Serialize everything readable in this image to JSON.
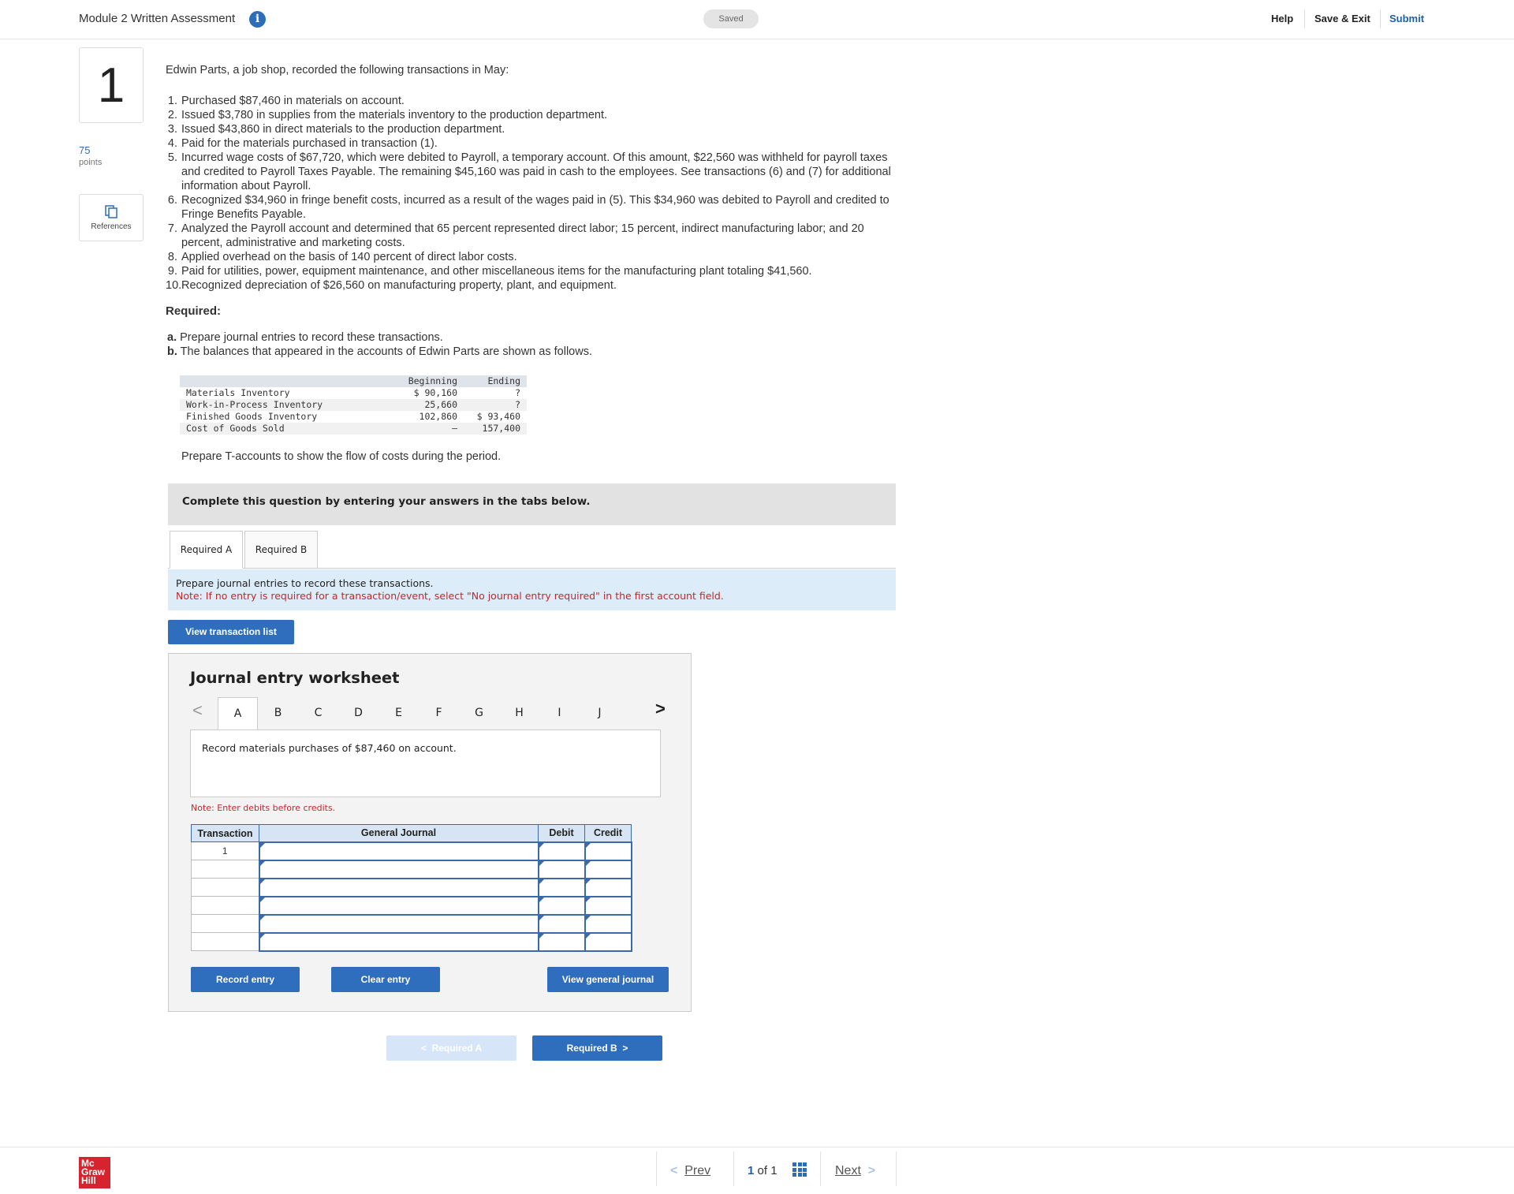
{
  "header": {
    "title": "Module 2 Written Assessment",
    "info_icon": "i",
    "saved": "Saved",
    "help": "Help",
    "save_exit": "Save & Exit",
    "submit": "Submit"
  },
  "question": {
    "number": "1",
    "points": "75",
    "points_label": "points",
    "references": "References"
  },
  "problem": {
    "intro": "Edwin Parts, a job shop, recorded the following transactions in May:",
    "transactions": [
      {
        "n": "1.",
        "text": "Purchased $87,460 in materials on account."
      },
      {
        "n": "2.",
        "text": "Issued $3,780 in supplies from the materials inventory to the production department."
      },
      {
        "n": "3.",
        "text": "Issued $43,860 in direct materials to the production department."
      },
      {
        "n": "4.",
        "text": "Paid for the materials purchased in transaction (1)."
      },
      {
        "n": "5.",
        "text": "Incurred wage costs of $67,720, which were debited to Payroll, a temporary account. Of this amount, $22,560 was withheld for payroll taxes and credited to Payroll Taxes Payable. The remaining $45,160 was paid in cash to the employees. See transactions (6) and (7) for additional information about Payroll."
      },
      {
        "n": "6.",
        "text": "Recognized $34,960 in fringe benefit costs, incurred as a result of the wages paid in (5). This $34,960 was debited to Payroll and credited to Fringe Benefits Payable."
      },
      {
        "n": "7.",
        "text": "Analyzed the Payroll account and determined that 65 percent represented direct labor; 15 percent, indirect manufacturing labor; and 20 percent, administrative and marketing costs."
      },
      {
        "n": "8.",
        "text": "Applied overhead on the basis of 140 percent of direct labor costs."
      },
      {
        "n": "9.",
        "text": "Paid for utilities, power, equipment maintenance, and other miscellaneous items for the manufacturing plant totaling $41,560."
      },
      {
        "n": "10.",
        "text": "Recognized depreciation of $26,560 on manufacturing property, plant, and equipment."
      }
    ],
    "required_heading": "Required:",
    "req_a_letter": "a.",
    "req_a": "Prepare journal entries to record these transactions.",
    "req_b_letter": "b.",
    "req_b": "The balances that appeared in the accounts of Edwin Parts are shown as follows.",
    "balances": {
      "headers": [
        "",
        "Beginning",
        "Ending"
      ],
      "rows": [
        [
          "Materials Inventory",
          "$ 90,160",
          "?"
        ],
        [
          "Work-in-Process Inventory",
          "25,660",
          "?"
        ],
        [
          "Finished Goods Inventory",
          "102,860",
          "$ 93,460"
        ],
        [
          "Cost of Goods Sold",
          "–",
          "157,400"
        ]
      ]
    },
    "t_accounts": "Prepare T-accounts to show the flow of costs during the period."
  },
  "complete_box": "Complete this question by entering your answers in the tabs below.",
  "tabs": [
    "Required A",
    "Required B"
  ],
  "instructions": {
    "line1": "Prepare journal entries to record these transactions.",
    "line2": "Note: If no entry is required for a transaction/event, select \"No journal entry required\" in the first account field."
  },
  "view_transaction_list": "View transaction list",
  "worksheet": {
    "title": "Journal entry worksheet",
    "prev": "<",
    "next": ">",
    "tabs": [
      "A",
      "B",
      "C",
      "D",
      "E",
      "F",
      "G",
      "H",
      "I",
      "J"
    ],
    "active_tab": "A",
    "description": "Record materials purchases of $87,460 on account.",
    "note": "Note: Enter debits before credits.",
    "columns": [
      "Transaction",
      "General Journal",
      "Debit",
      "Credit"
    ],
    "rows": [
      {
        "transaction": "1",
        "account": "",
        "debit": "",
        "credit": ""
      },
      {
        "transaction": "",
        "account": "",
        "debit": "",
        "credit": ""
      },
      {
        "transaction": "",
        "account": "",
        "debit": "",
        "credit": ""
      },
      {
        "transaction": "",
        "account": "",
        "debit": "",
        "credit": ""
      },
      {
        "transaction": "",
        "account": "",
        "debit": "",
        "credit": ""
      },
      {
        "transaction": "",
        "account": "",
        "debit": "",
        "credit": ""
      }
    ],
    "record_entry": "Record entry",
    "clear_entry": "Clear entry",
    "view_general_journal": "View general journal"
  },
  "nav_buttons": {
    "prev_req": "Required A",
    "next_req": "Required B",
    "prev_chev": "<",
    "next_chev": ">"
  },
  "footer": {
    "logo": [
      "Mc",
      "Graw",
      "Hill"
    ],
    "prev": "Prev",
    "page_current": "1",
    "page_of": "of",
    "page_total": "1",
    "next": "Next",
    "chev_left": "<",
    "chev_right": ">"
  },
  "colors": {
    "accent_blue": "#2e6ebc",
    "link_blue": "#1f5fa9",
    "note_red": "#c0282d",
    "instruction_bg": "#dcedf9",
    "logo_red": "#d6232d"
  }
}
